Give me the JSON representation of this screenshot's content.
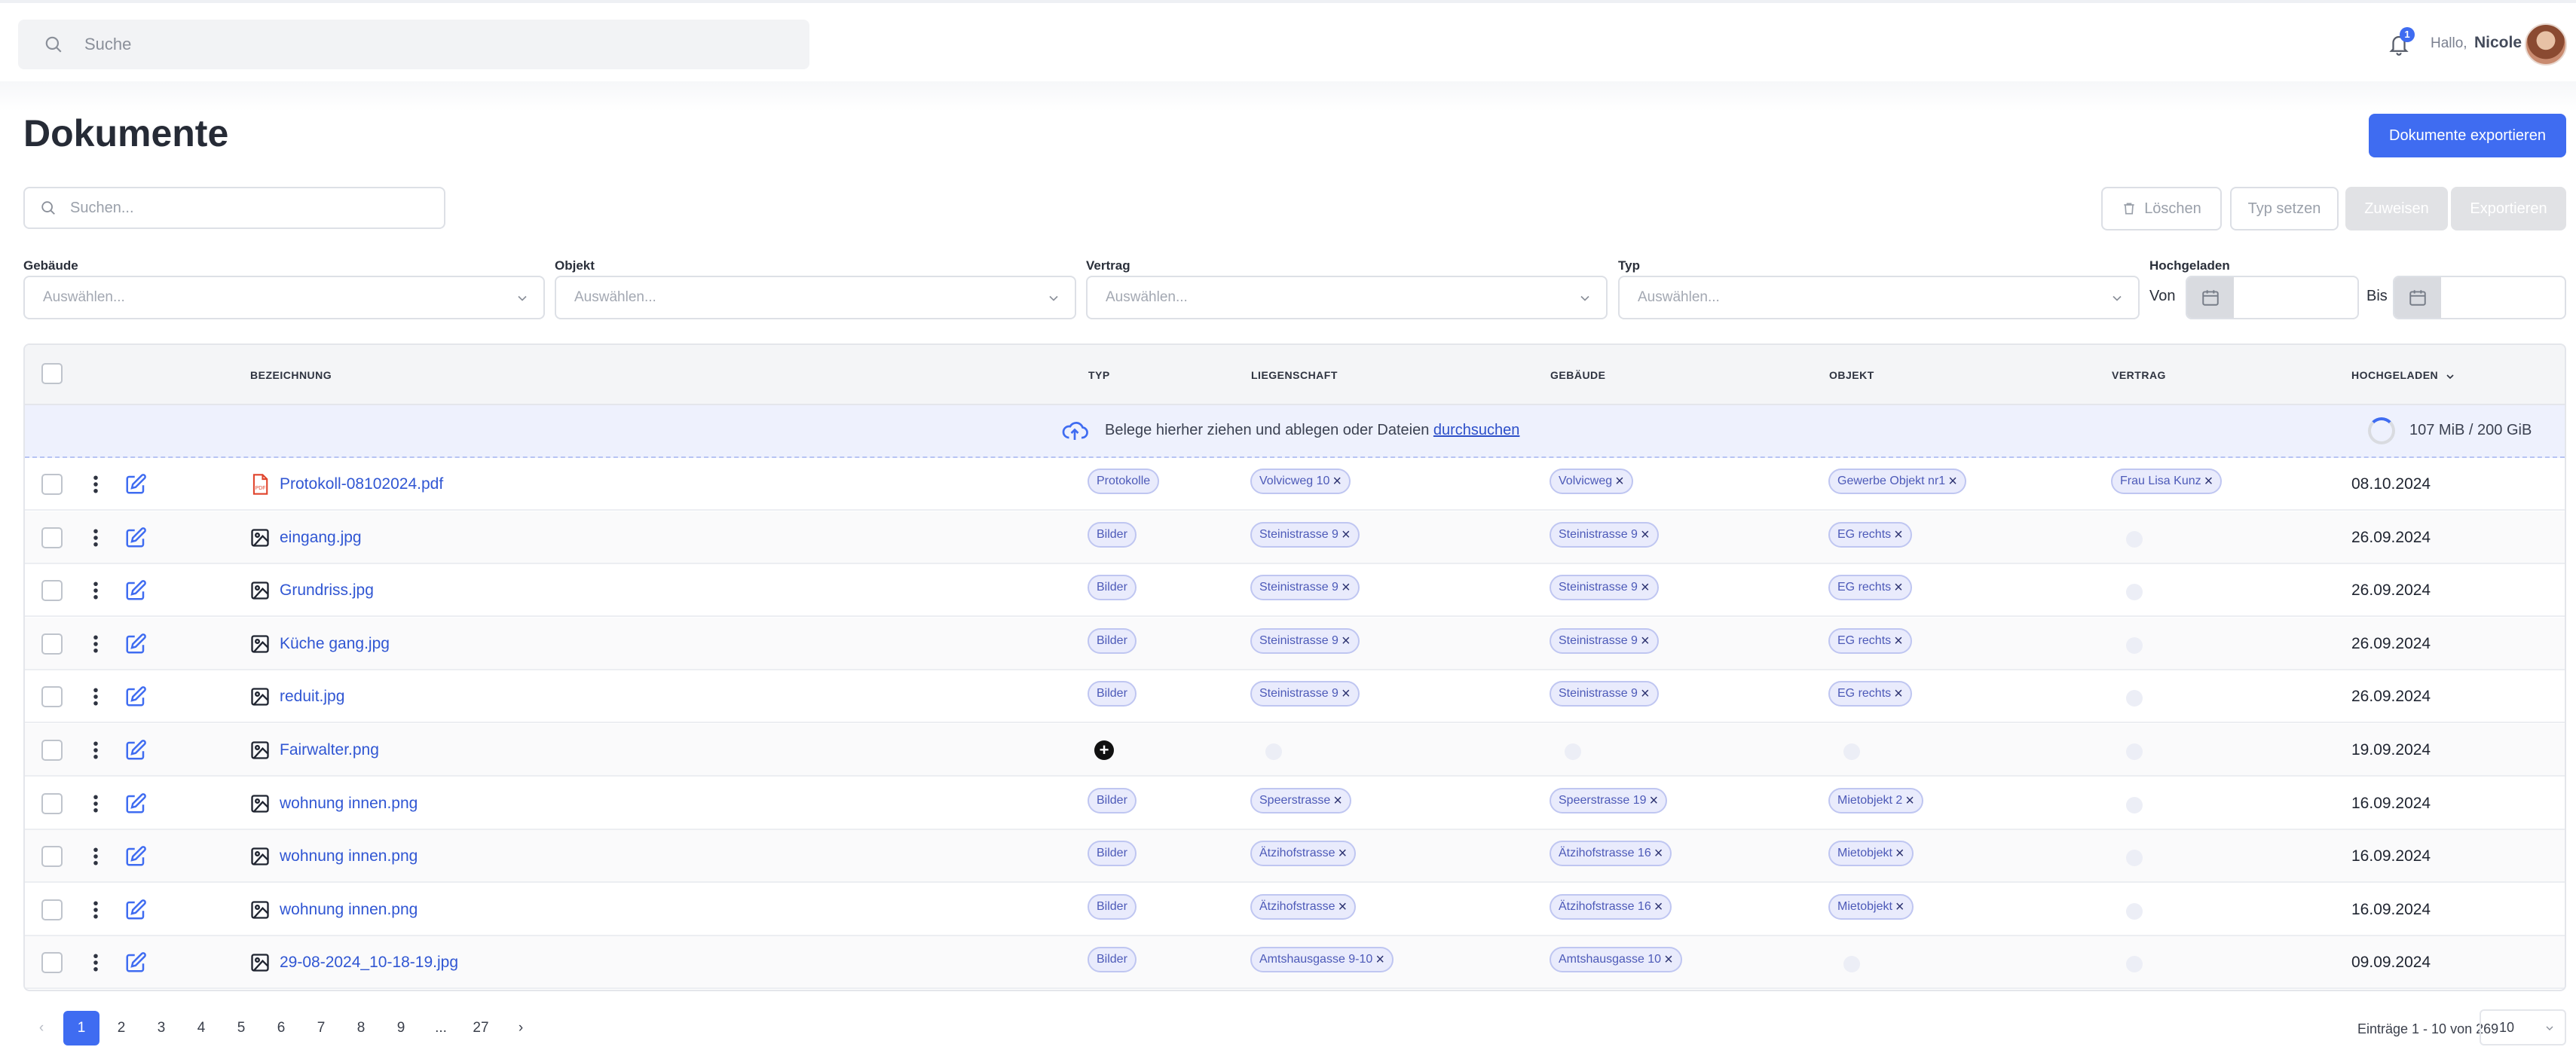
{
  "topbar": {
    "search_placeholder": "Suche",
    "notification_count": "1",
    "greeting": "Hallo,",
    "user_name": "Nicole"
  },
  "page": {
    "title": "Dokumente",
    "export_all_label": "Dokumente exportieren",
    "search_placeholder": "Suchen...",
    "actions": {
      "delete": "Löschen",
      "set_type": "Typ setzen",
      "assign": "Zuweisen",
      "export": "Exportieren"
    }
  },
  "filters": {
    "building_label": "Gebäude",
    "object_label": "Objekt",
    "contract_label": "Vertrag",
    "type_label": "Typ",
    "uploaded_label": "Hochgeladen",
    "select_placeholder": "Auswählen...",
    "from_label": "Von",
    "to_label": "Bis"
  },
  "table": {
    "headers": {
      "name": "BEZEICHNUNG",
      "type": "TYP",
      "property": "LIEGENSCHAFT",
      "building": "GEBÄUDE",
      "object": "OBJEKT",
      "contract": "VERTRAG",
      "uploaded": "HOCHGELADEN"
    },
    "dropzone_text": "Belege hierher ziehen und ablegen oder Dateien",
    "dropzone_link": "durchsuchen",
    "storage": "107 MiB / 200 GiB",
    "rows": [
      {
        "icon": "pdf-icon",
        "name": "Protokoll-08102024.pdf",
        "type": "Protokolle",
        "property": "Volvicweg 10",
        "building": "Volvicweg",
        "object": "Gewerbe Objekt nr1",
        "contract": "Frau Lisa Kunz",
        "date": "08.10.2024"
      },
      {
        "icon": "image-icon",
        "name": "eingang.jpg",
        "type": "Bilder",
        "property": "Steinistrasse 9",
        "building": "Steinistrasse 9",
        "object": "EG rechts",
        "contract": "",
        "date": "26.09.2024"
      },
      {
        "icon": "image-icon",
        "name": "Grundriss.jpg",
        "type": "Bilder",
        "property": "Steinistrasse 9",
        "building": "Steinistrasse 9",
        "object": "EG rechts",
        "contract": "",
        "date": "26.09.2024"
      },
      {
        "icon": "image-icon",
        "name": "Küche gang.jpg",
        "type": "Bilder",
        "property": "Steinistrasse 9",
        "building": "Steinistrasse 9",
        "object": "EG rechts",
        "contract": "",
        "date": "26.09.2024"
      },
      {
        "icon": "image-icon",
        "name": "reduit.jpg",
        "type": "Bilder",
        "property": "Steinistrasse 9",
        "building": "Steinistrasse 9",
        "object": "EG rechts",
        "contract": "",
        "date": "26.09.2024"
      },
      {
        "icon": "image-icon",
        "name": "Fairwalter.png",
        "type": "",
        "property": "",
        "building": "",
        "object": "",
        "contract": "",
        "date": "19.09.2024"
      },
      {
        "icon": "image-icon",
        "name": "wohnung innen.png",
        "type": "Bilder",
        "property": "Speerstrasse",
        "building": "Speerstrasse 19",
        "object": "Mietobjekt 2",
        "contract": "",
        "date": "16.09.2024"
      },
      {
        "icon": "image-icon",
        "name": "wohnung innen.png",
        "type": "Bilder",
        "property": "Ätzihofstrasse",
        "building": "Ätzihofstrasse 16",
        "object": "Mietobjekt",
        "contract": "",
        "date": "16.09.2024"
      },
      {
        "icon": "image-icon",
        "name": "wohnung innen.png",
        "type": "Bilder",
        "property": "Ätzihofstrasse",
        "building": "Ätzihofstrasse 16",
        "object": "Mietobjekt",
        "contract": "",
        "date": "16.09.2024"
      },
      {
        "icon": "image-icon",
        "name": "29-08-2024_10-18-19.jpg",
        "type": "Bilder",
        "property": "Amtshausgasse 9-10",
        "building": "Amtshausgasse 10",
        "object": "",
        "contract": "",
        "date": "09.09.2024"
      }
    ]
  },
  "pagination": {
    "pages": [
      "1",
      "2",
      "3",
      "4",
      "5",
      "6",
      "7",
      "8",
      "9",
      "...",
      "27"
    ],
    "current": "1",
    "entries_text": "Einträge 1 - 10 von 269",
    "per_page": "10"
  },
  "colors": {
    "accent": "#3f6cf1",
    "link": "#3056d3",
    "chip_bg": "#e9ebfc",
    "chip_border": "#bfc6f1"
  }
}
